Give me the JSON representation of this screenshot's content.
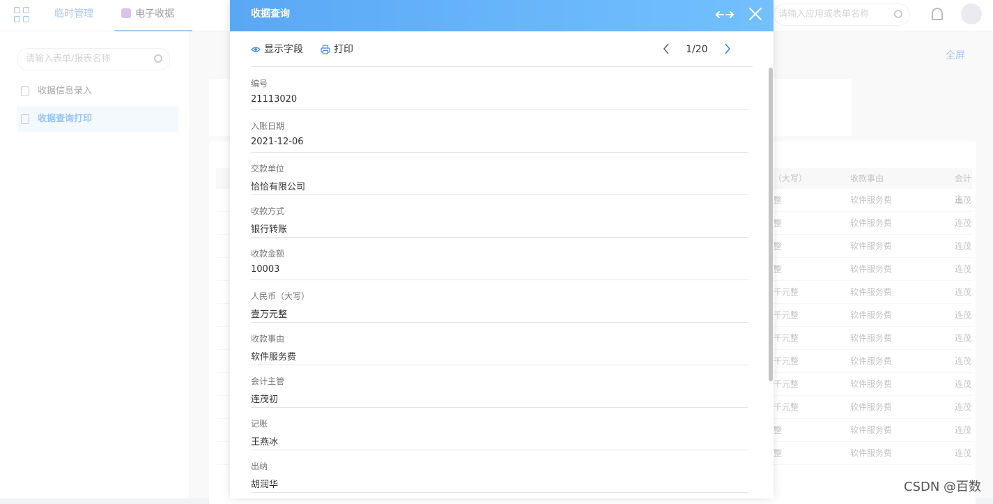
{
  "app": {
    "top_tabs": [
      {
        "label": "临时管理"
      },
      {
        "label": "电子收据"
      }
    ],
    "search_placeholder": "请输入应用或表单名称"
  },
  "sidebar": {
    "search_placeholder": "请输入表单/报表名称",
    "items": [
      {
        "label": "收据信息录入"
      },
      {
        "label": "收据查询打印"
      }
    ]
  },
  "main": {
    "fullscreen_label": "全屏",
    "table_headers": [
      "（大写）",
      "收款事由",
      "会计主"
    ],
    "rows": [
      [
        "整",
        "软件服务费",
        "连茂"
      ],
      [
        "整",
        "软件服务费",
        "连茂"
      ],
      [
        "整",
        "软件服务费",
        "连茂"
      ],
      [
        "整",
        "软件服务费",
        "连茂"
      ],
      [
        "千元整",
        "软件服务费",
        "连茂"
      ],
      [
        "千元整",
        "软件服务费",
        "连茂"
      ],
      [
        "千元整",
        "软件服务费",
        "连茂"
      ],
      [
        "千元整",
        "软件服务费",
        "连茂"
      ],
      [
        "千元整",
        "软件服务费",
        "连茂"
      ],
      [
        "千元整",
        "软件服务费",
        "连茂"
      ],
      [
        "整",
        "软件服务费",
        "连茂"
      ],
      [
        "整",
        "软件服务费",
        "连茂"
      ]
    ]
  },
  "modal": {
    "title": "收据查询",
    "show_fields_label": "显示字段",
    "print_label": "打印",
    "pager": "1/20",
    "fields": [
      {
        "label": "编号",
        "value": "21113020"
      },
      {
        "label": "入账日期",
        "value": "2021-12-06"
      },
      {
        "label": "交款单位",
        "value": "恰恰有限公司"
      },
      {
        "label": "收款方式",
        "value": "银行转账"
      },
      {
        "label": "收款金额",
        "value": "10003"
      },
      {
        "label": "人民币（大写）",
        "value": "壹万元整"
      },
      {
        "label": "收款事由",
        "value": "软件服务费"
      },
      {
        "label": "会计主管",
        "value": "连茂初"
      },
      {
        "label": "记账",
        "value": "王燕冰"
      },
      {
        "label": "出纳",
        "value": "胡润华"
      }
    ]
  },
  "watermark": "CSDN @百数"
}
